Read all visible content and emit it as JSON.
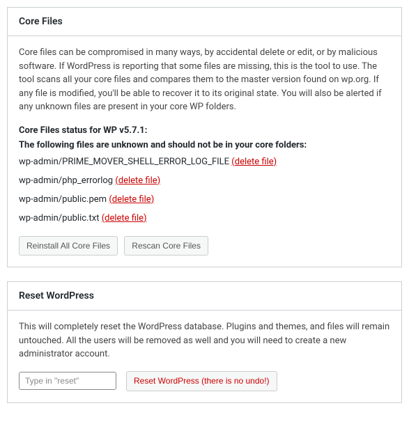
{
  "core_files": {
    "title": "Core Files",
    "description": "Core files can be compromised in many ways, by accidental delete or edit, or by malicious software. If WordPress is reporting that some files are missing, this is the tool to use. The tool scans all your core files and compares them to the master version found on wp.org. If any file is modified, you'll be able to recover it to its original state.\nYou will also be alerted if any unknown files are present in your core WP folders.",
    "status_heading": "Core Files status for WP v5.7.1:",
    "status_subheading": "The following files are unknown and should not be in your core folders:",
    "files": [
      {
        "path": "wp-admin/PRIME_MOVER_SHELL_ERROR_LOG_FILE",
        "action": "(delete file)"
      },
      {
        "path": "wp-admin/php_errorlog",
        "action": "(delete file)"
      },
      {
        "path": "wp-admin/public.pem",
        "action": "(delete file)"
      },
      {
        "path": "wp-admin/public.txt",
        "action": "(delete file)"
      }
    ],
    "reinstall_button": "Reinstall All Core Files",
    "rescan_button": "Rescan Core Files"
  },
  "reset_wp": {
    "title": "Reset WordPress",
    "description": "This will completely reset the WordPress database. Plugins and themes, and files will remain untouched. All the users will be removed as well and you will need to create a new administrator account.",
    "input_placeholder": "Type in \"reset\"",
    "reset_button": "Reset WordPress (there is no undo!)"
  }
}
